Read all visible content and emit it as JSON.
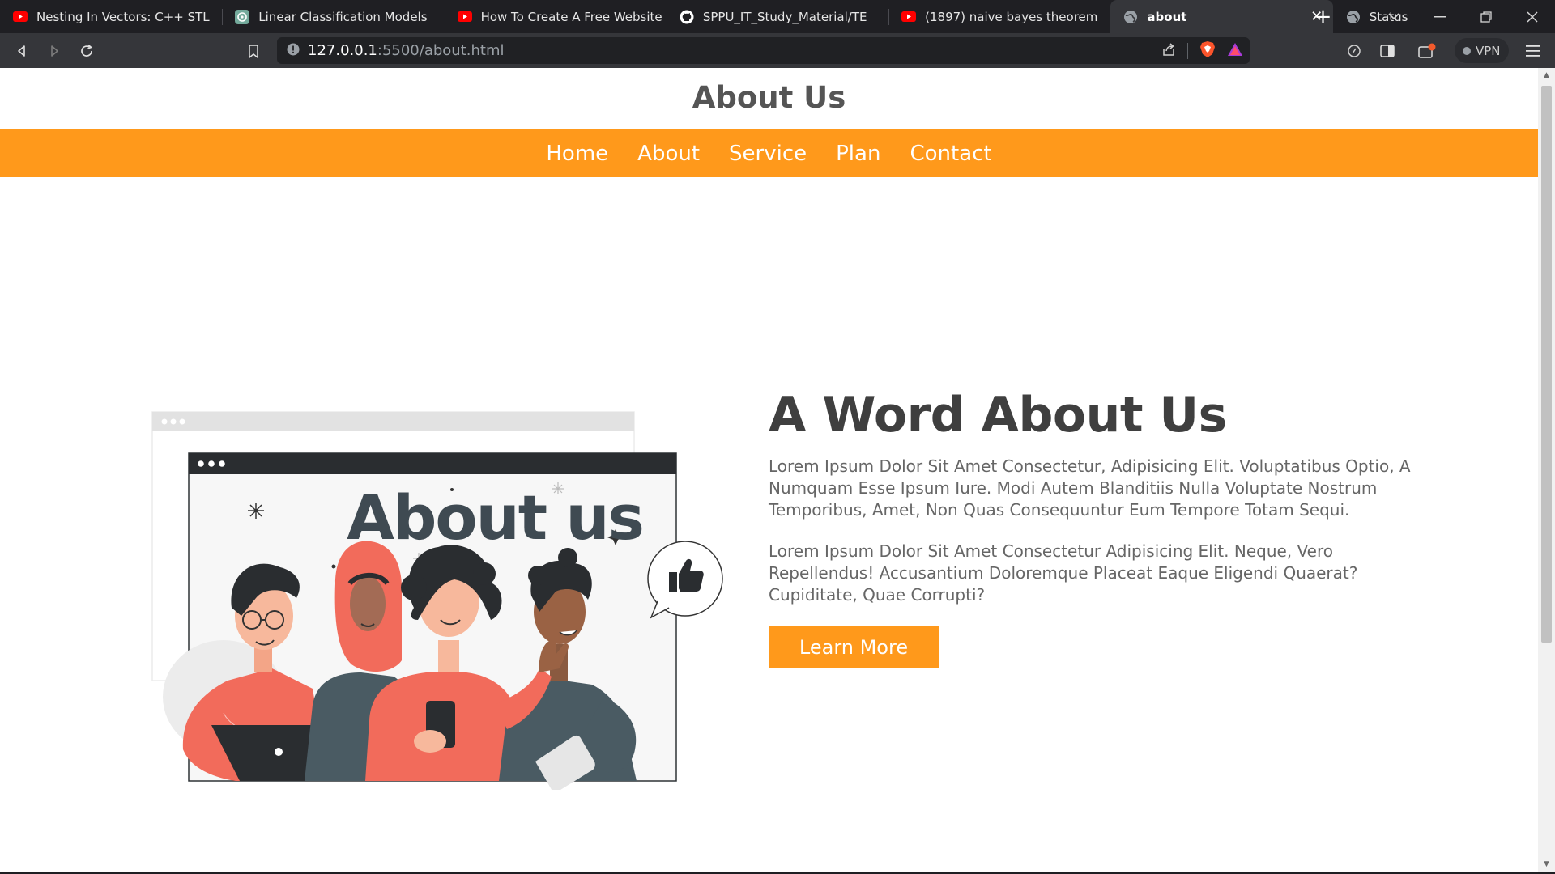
{
  "browser": {
    "tabs": [
      {
        "title": "Nesting In Vectors: C++ STL",
        "icon": "youtube-icon",
        "active": false
      },
      {
        "title": "Linear Classification Models",
        "icon": "chatgpt-icon",
        "active": false
      },
      {
        "title": "How To Create A Free Website",
        "icon": "youtube-icon",
        "active": false
      },
      {
        "title": "SPPU_IT_Study_Material/TE",
        "icon": "github-icon",
        "active": false
      },
      {
        "title": "(1897) naive bayes theorem",
        "icon": "youtube-icon",
        "active": false
      },
      {
        "title": "about",
        "icon": "globe-icon",
        "active": true
      },
      {
        "title": "Status",
        "icon": "globe-icon",
        "active": false
      }
    ],
    "url": {
      "host": "127.0.0.1",
      "path": ":5500/about.html"
    },
    "vpn_label": "VPN"
  },
  "page": {
    "site_title": "About Us",
    "nav": [
      "Home",
      "About",
      "Service",
      "Plan",
      "Contact"
    ],
    "illustration": {
      "text": "About us"
    },
    "heading": "A Word About Us",
    "paragraph1": "Lorem Ipsum Dolor Sit Amet Consectetur, Adipisicing Elit. Voluptatibus Optio, A Numquam Esse Ipsum Iure. Modi Autem Blanditiis Nulla Voluptate Nostrum Temporibus, Amet, Non Quas Consequuntur Eum Tempore Totam Sequi.",
    "paragraph2": "Lorem Ipsum Dolor Sit Amet Consectetur Adipisicing Elit. Neque, Vero Repellendus! Accusantium Doloremque Placeat Eaque Eligendi Quaerat? Cupiditate, Quae Corrupti?",
    "button_label": "Learn More"
  },
  "colors": {
    "accent": "#ff991b",
    "tab_bg": "#1f1f23",
    "toolbar_bg": "#35363a",
    "coral": "#f26b5b",
    "slate": "#455a64"
  }
}
